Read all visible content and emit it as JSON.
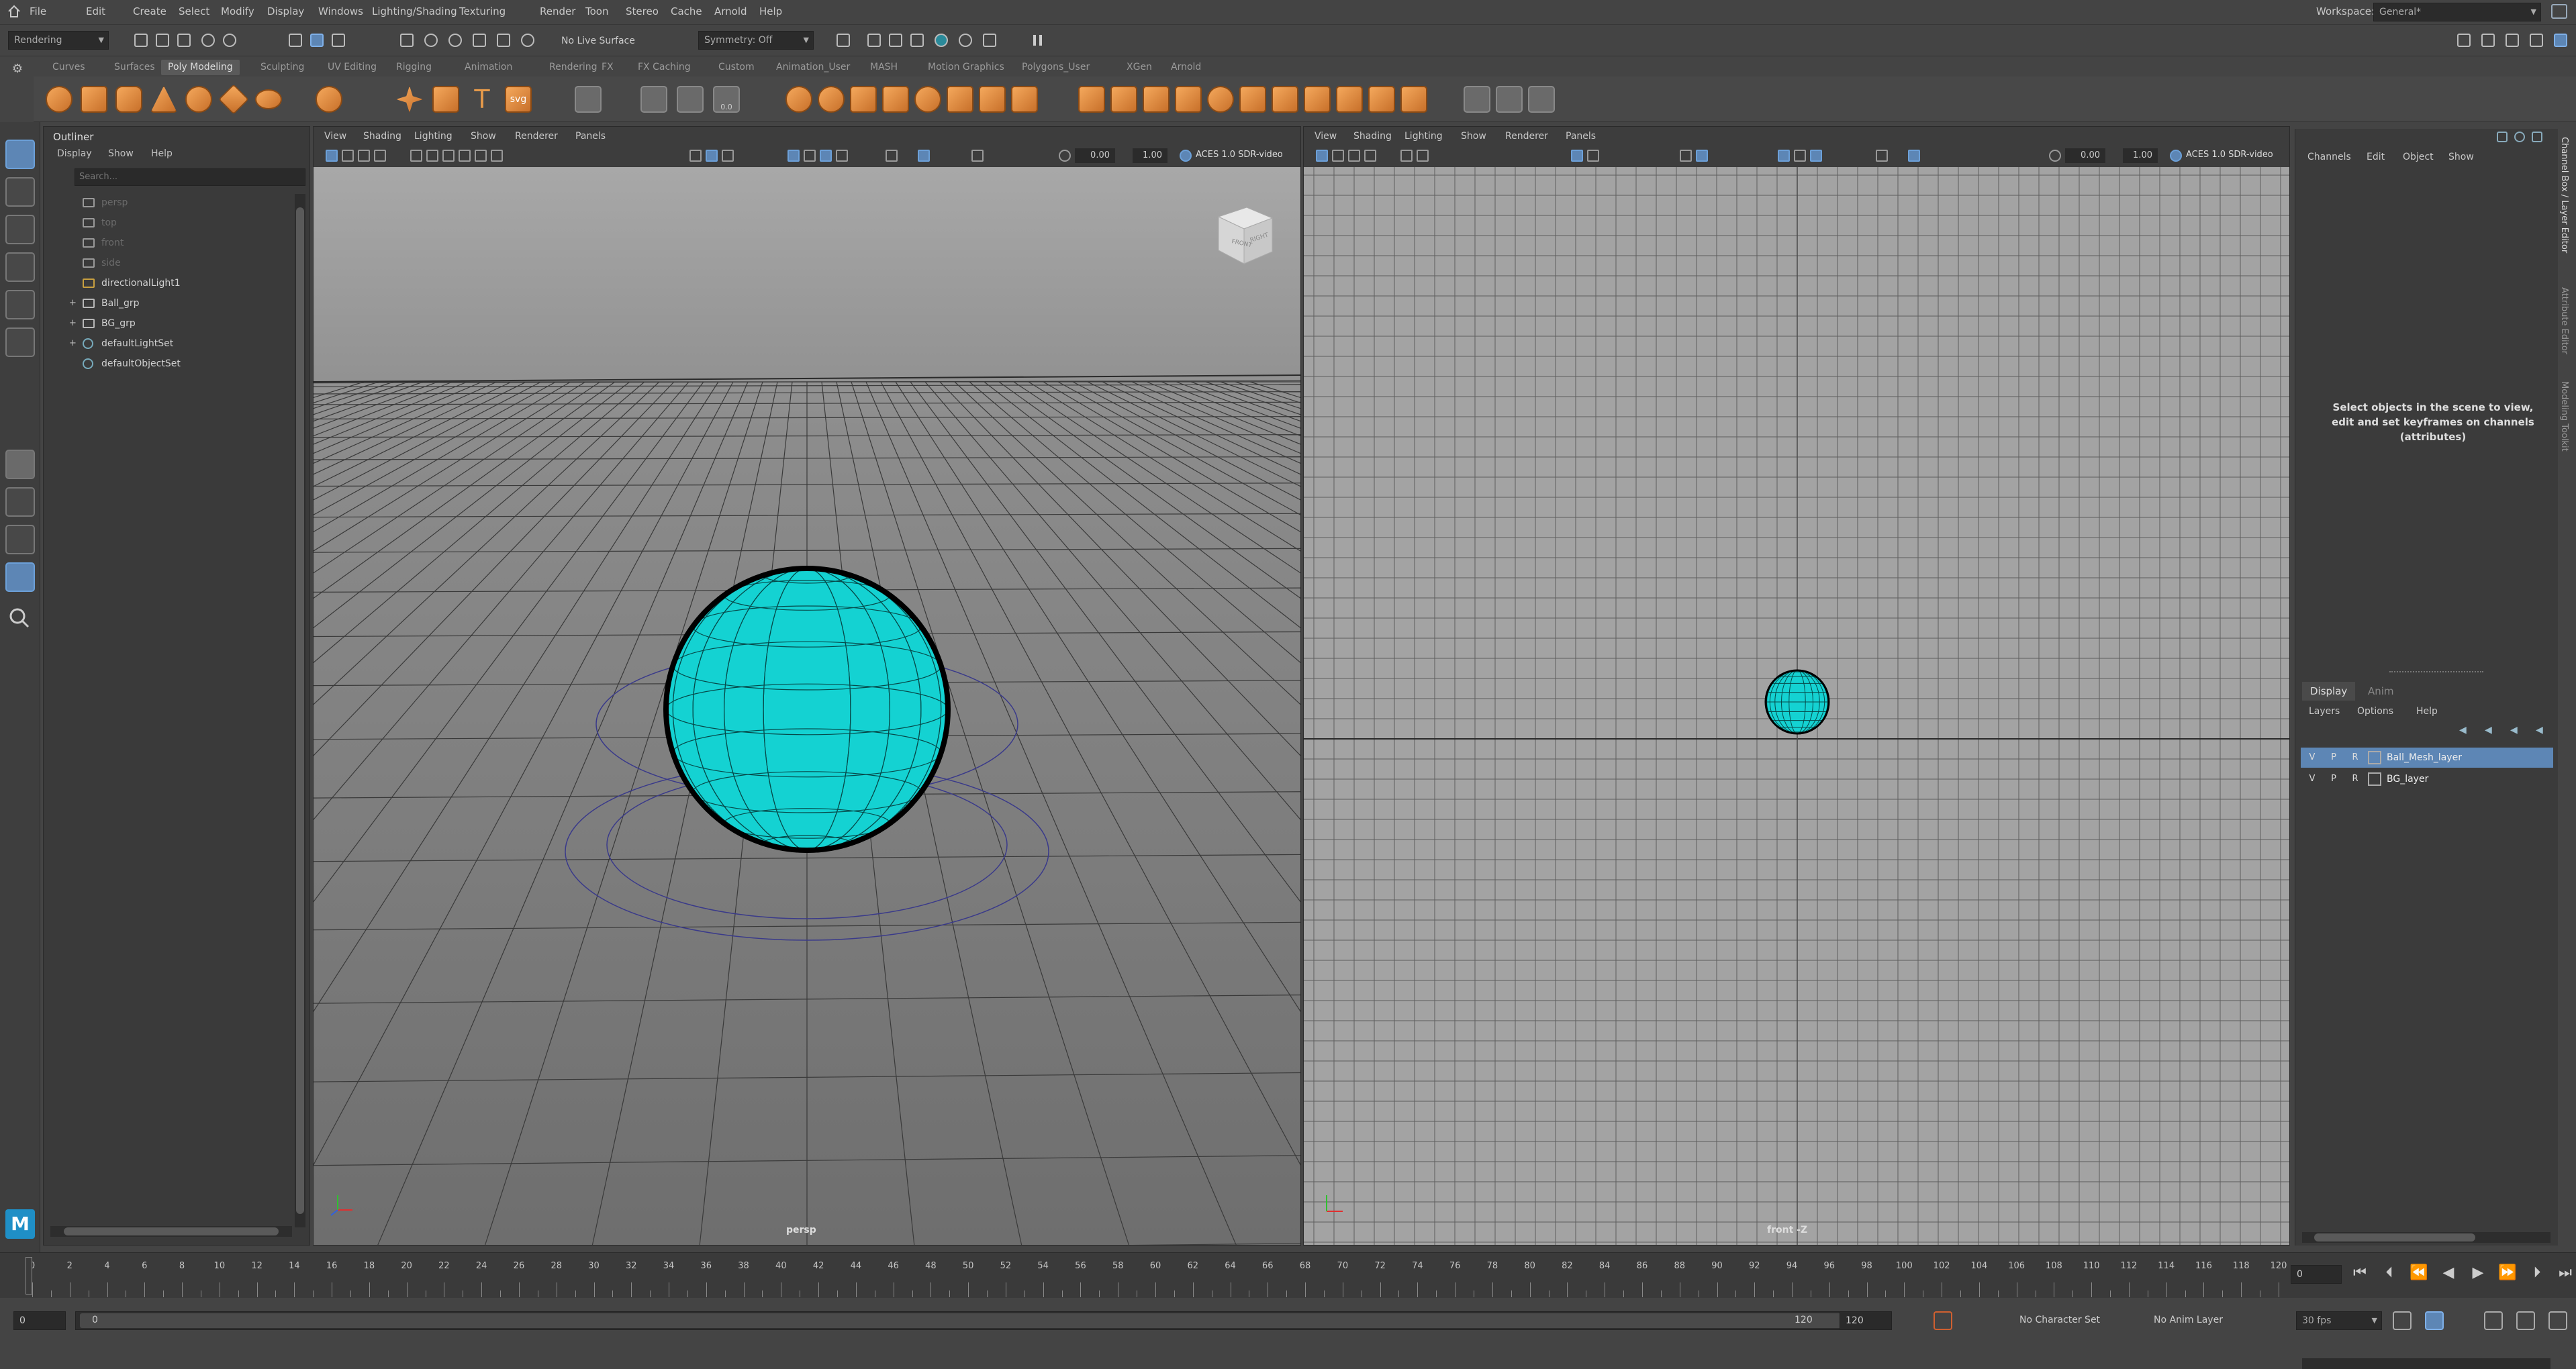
{
  "menubar": {
    "items": [
      "File",
      "Edit",
      "Create",
      "Select",
      "Modify",
      "Display",
      "Windows",
      "Lighting/Shading",
      "Texturing",
      "Render",
      "Toon",
      "Stereo",
      "Cache",
      "Arnold",
      "Help"
    ],
    "workspace_label": "Workspace:",
    "workspace_value": "General*"
  },
  "statusline": {
    "menuset": "Rendering",
    "live_surface": "No Live Surface",
    "symmetry": "Symmetry: Off"
  },
  "shelf": {
    "tabs": [
      "Curves",
      "Surfaces",
      "Poly Modeling",
      "Sculpting",
      "UV Editing",
      "Rigging",
      "Animation",
      "Rendering",
      "FX",
      "FX Caching",
      "Custom",
      "Animation_User",
      "MASH",
      "Motion Graphics",
      "Polygons_User",
      "XGen",
      "Arnold"
    ],
    "active_tab": "Poly Modeling"
  },
  "outliner": {
    "title": "Outliner",
    "menus": [
      "Display",
      "Show",
      "Help"
    ],
    "search_placeholder": "Search...",
    "items": [
      {
        "label": "persp",
        "kind": "camera",
        "dim": true,
        "expandable": false
      },
      {
        "label": "top",
        "kind": "camera",
        "dim": true,
        "expandable": false
      },
      {
        "label": "front",
        "kind": "camera",
        "dim": true,
        "expandable": false
      },
      {
        "label": "side",
        "kind": "camera",
        "dim": true,
        "expandable": false
      },
      {
        "label": "directionalLight1",
        "kind": "light",
        "dim": false,
        "expandable": false
      },
      {
        "label": "Ball_grp",
        "kind": "group",
        "dim": false,
        "expandable": true
      },
      {
        "label": "BG_grp",
        "kind": "group",
        "dim": false,
        "expandable": true
      },
      {
        "label": "defaultLightSet",
        "kind": "set",
        "dim": false,
        "expandable": true
      },
      {
        "label": "defaultObjectSet",
        "kind": "set",
        "dim": false,
        "expandable": false
      }
    ]
  },
  "viewport_left": {
    "menus": [
      "View",
      "Shading",
      "Lighting",
      "Show",
      "Renderer",
      "Panels"
    ],
    "exposure": "0.00",
    "gamma": "1.00",
    "colorspace": "ACES 1.0 SDR-video",
    "camera_label": "persp",
    "viewcube_front": "FRONT",
    "viewcube_right": "RIGHT"
  },
  "viewport_right": {
    "menus": [
      "View",
      "Shading",
      "Lighting",
      "Show",
      "Renderer",
      "Panels"
    ],
    "exposure": "0.00",
    "gamma": "1.00",
    "colorspace": "ACES 1.0 SDR-video",
    "camera_label": "front -Z"
  },
  "channel_box": {
    "menus": [
      "Channels",
      "Edit",
      "Object",
      "Show"
    ],
    "help_text": "Select objects in the scene to view, edit and set keyframes on channels (attributes)"
  },
  "layer_editor": {
    "tabs": [
      "Display",
      "Anim"
    ],
    "active_tab": "Display",
    "menus": [
      "Layers",
      "Options",
      "Help"
    ],
    "layers": [
      {
        "name": "Ball_Mesh_layer",
        "v": "V",
        "p": "P",
        "r": "R",
        "selected": true
      },
      {
        "name": "BG_layer",
        "v": "V",
        "p": "P",
        "r": "R",
        "selected": false
      }
    ]
  },
  "side_tabs": [
    "Channel Box / Layer Editor",
    "Attribute Editor",
    "Modeling Toolkit"
  ],
  "timeline": {
    "ticks": [
      "0",
      "2",
      "4",
      "6",
      "8",
      "10",
      "12",
      "14",
      "16",
      "18",
      "20",
      "22",
      "24",
      "26",
      "28",
      "30",
      "32",
      "34",
      "36",
      "38",
      "40",
      "42",
      "44",
      "46",
      "48",
      "50",
      "52",
      "54",
      "56",
      "58",
      "60",
      "62",
      "64",
      "66",
      "68",
      "70",
      "72",
      "74",
      "76",
      "78",
      "80",
      "82",
      "84",
      "86",
      "88",
      "90",
      "92",
      "94",
      "96",
      "98",
      "100",
      "102",
      "104",
      "106",
      "108",
      "110",
      "112",
      "114",
      "116",
      "118",
      "120"
    ],
    "current_frame": "0"
  },
  "range": {
    "start": "0",
    "inner_start": "0",
    "inner_end": "120",
    "end": "120",
    "character_set": "No Character Set",
    "anim_layer": "No Anim Layer",
    "fps": "30 fps"
  },
  "colors": {
    "sphere": "#14d2d2",
    "accent": "#5d86b5"
  }
}
